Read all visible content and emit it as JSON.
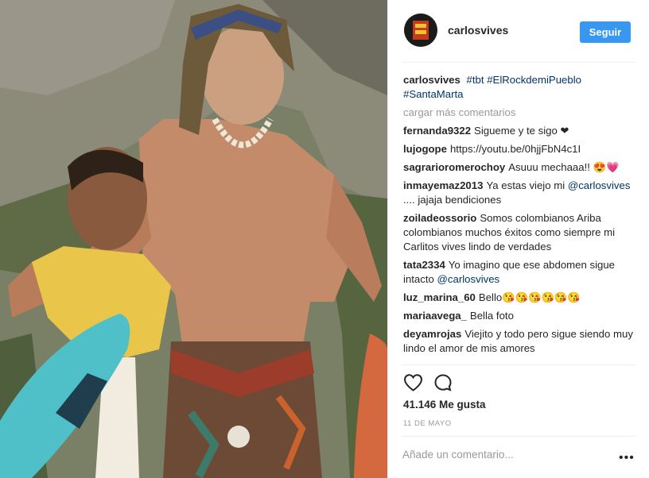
{
  "post": {
    "username": "carlosvives",
    "follow_label": "Seguir",
    "caption": {
      "user": "carlosvives",
      "tags": [
        "#tbt",
        "#ElRockdemiPueblo",
        "#SantaMarta"
      ]
    },
    "load_more": "cargar más comentarios",
    "comments": [
      {
        "user": "fernanda9322",
        "text": "Sigueme y te sigo ❤"
      },
      {
        "user": "lujogope",
        "text": "https://youtu.be/0hjjFbN4c1I"
      },
      {
        "user": "sagrarioromerochoy",
        "text": "Asuuu mechaaa!! 😍💗"
      },
      {
        "user": "inmayemaz2013",
        "text": "Ya estas viejo mi",
        "mention": "@carlosvives",
        "after": ".... jajaja bendiciones"
      },
      {
        "user": "zoiladeossorio",
        "text": "Somos colombianos Ariba colombianos muchos éxitos como siempre mi Carlitos vives lindo de verdades"
      },
      {
        "user": "tata2334",
        "text": "Yo imagino que ese abdomen sigue intacto",
        "mention": "@carlosvives"
      },
      {
        "user": "luz_marina_60",
        "text": "Bello😘😘😘😘😘😘"
      },
      {
        "user": "mariaavega_",
        "text": "Bella foto"
      },
      {
        "user": "deyamrojas",
        "text": "Viejito y todo pero sigue siendo muy lindo el amor de mis amores"
      }
    ],
    "likes": "41.146 Me gusta",
    "date": "11 DE MAYO",
    "add_comment_placeholder": "Añade un comentario...",
    "more_options": "•••",
    "colors": {
      "accent": "#3897f0",
      "hashtag": "#003569",
      "muted": "#999999"
    },
    "icons": [
      "heart-icon",
      "comment-icon"
    ]
  }
}
